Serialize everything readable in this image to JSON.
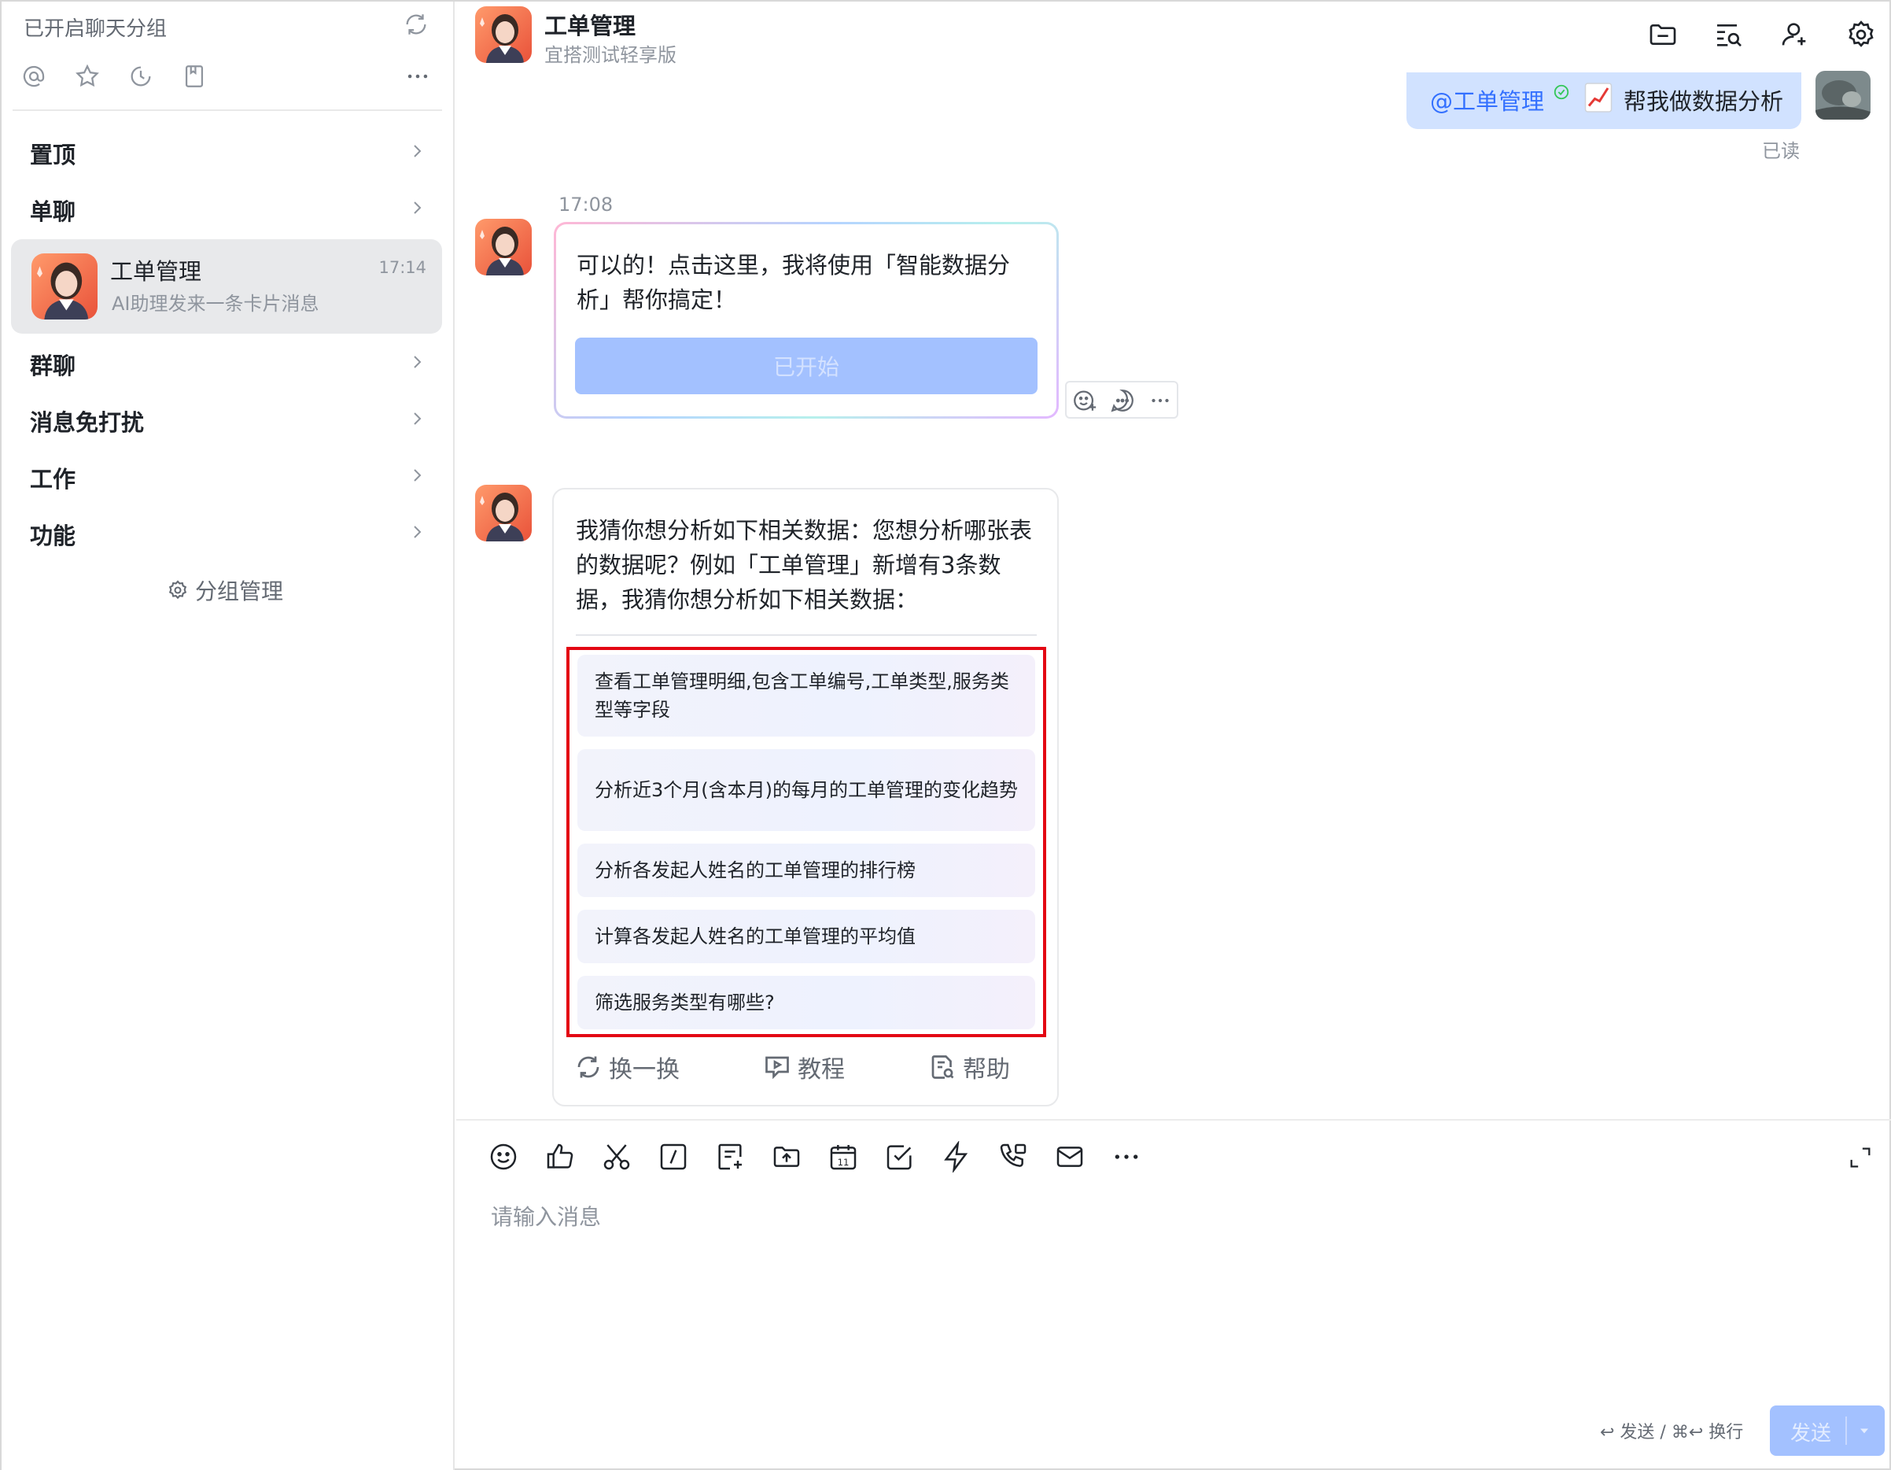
{
  "sidebar": {
    "header": "已开启聊天分组",
    "sections": {
      "pinned": "置顶",
      "single": "单聊",
      "group": "群聊",
      "mute": "消息免打扰",
      "work": "工作",
      "feature": "功能"
    },
    "chat": {
      "name": "工单管理",
      "time": "17:14",
      "preview": "AI助理发来一条卡片消息"
    },
    "manage": "分组管理"
  },
  "header": {
    "title": "工单管理",
    "subtitle": "宜搭测试轻享版"
  },
  "user_message": {
    "mention": "@工单管理",
    "text": "帮我做数据分析",
    "status": "已读"
  },
  "bot_message_1": {
    "time": "17:08",
    "text": "可以的！点击这里，我将使用「智能数据分析」帮你搞定！",
    "button": "已开始"
  },
  "bot_message_2": {
    "text": "我猜你想分析如下相关数据：您想分析哪张表的数据呢？例如「工单管理」新增有3条数据，我猜你想分析如下相关数据：",
    "suggestions": [
      "查看工单管理明细,包含工单编号,工单类型,服务类型等字段",
      "分析近3个月(含本月)的每月的工单管理的变化趋势",
      "分析各发起人姓名的工单管理的排行榜",
      "计算各发起人姓名的工单管理的平均值",
      "筛选服务类型有哪些?"
    ],
    "actions": {
      "refresh": "换一换",
      "tutorial": "教程",
      "help": "帮助"
    }
  },
  "composer": {
    "placeholder": "请输入消息",
    "hint": "↩ 发送 / ⌘↩ 换行",
    "send": "发送",
    "tools": [
      "emoji-icon",
      "thumbs-up-icon",
      "scissors-icon",
      "command-icon",
      "doc-add-icon",
      "folder-upload-icon",
      "calendar-icon",
      "task-icon",
      "lightning-icon",
      "phone-icon",
      "mail-icon",
      "more-icon"
    ]
  }
}
